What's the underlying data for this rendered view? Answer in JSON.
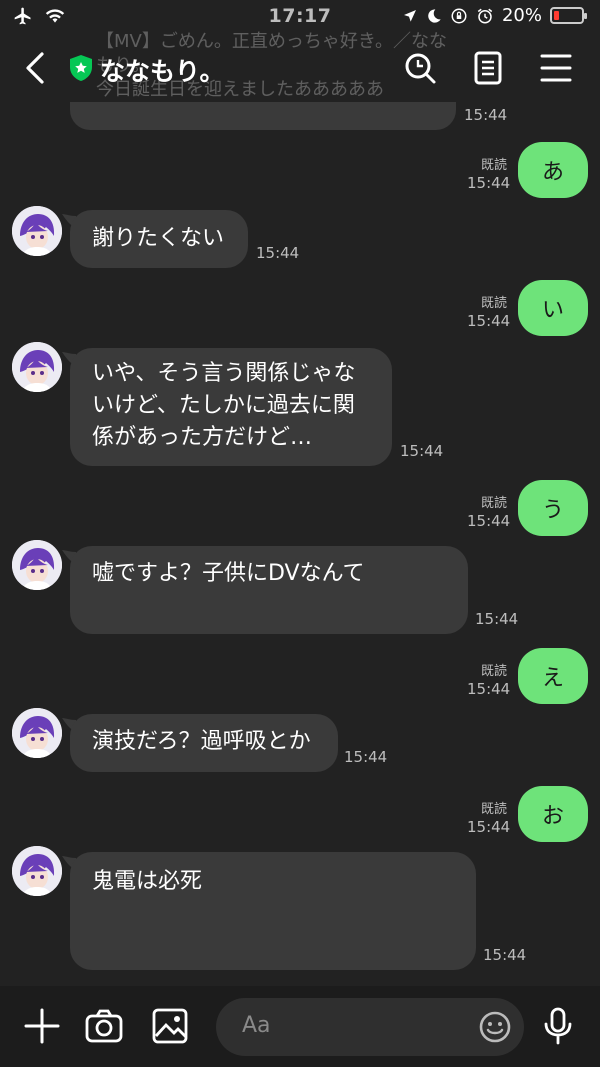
{
  "status_bar": {
    "time": "17:17",
    "battery_percent": "20%"
  },
  "header": {
    "title": "ななもり。",
    "background_preview": "【MV】ごめん。正直めっちゃ好き。／ななもり。\n今日誕生日を迎えましたあああああ"
  },
  "messages": [
    {
      "type": "in",
      "text": "謝りたくない",
      "time": "15:44"
    },
    {
      "type": "out",
      "text": "あ",
      "read": "既読",
      "time": "15:44"
    },
    {
      "type": "out",
      "text": "い",
      "read": "既読",
      "time": "15:44"
    },
    {
      "type": "in",
      "text": "いや、そう言う関係じゃないけど、たしかに過去に関係があった方だけど…",
      "time": "15:44"
    },
    {
      "type": "out",
      "text": "う",
      "read": "既読",
      "time": "15:44"
    },
    {
      "type": "in",
      "text": "嘘ですよ？子供にDVなんて",
      "time": "15:44"
    },
    {
      "type": "out",
      "text": "え",
      "read": "既読",
      "time": "15:44"
    },
    {
      "type": "in",
      "text": "演技だろ？過呼吸とか",
      "time": "15:44"
    },
    {
      "type": "out",
      "text": "お",
      "read": "既読",
      "time": "15:44"
    },
    {
      "type": "in",
      "text": "鬼電は必死",
      "time": "15:44"
    }
  ],
  "prev_time": "15:44",
  "composer": {
    "placeholder": "Aa"
  },
  "colors": {
    "background": "#222222",
    "bubble_in": "#3a3a3a",
    "bubble_out": "#6ee37a",
    "shield": "#06c755"
  }
}
